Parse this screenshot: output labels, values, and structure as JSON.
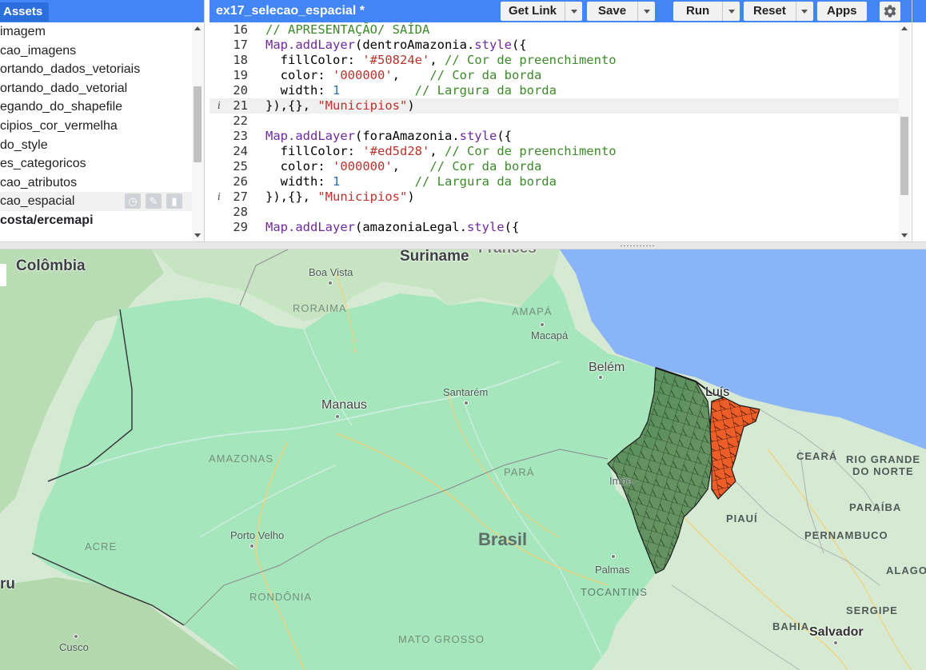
{
  "assets": {
    "tab_label": "Assets",
    "items": [
      {
        "label": "imagem"
      },
      {
        "label": "cao_imagens"
      },
      {
        "label": "ortando_dados_vetoriais"
      },
      {
        "label": "ortando_dado_vetorial"
      },
      {
        "label": "egando_do_shapefile"
      },
      {
        "label": "cipios_cor_vermelha"
      },
      {
        "label": "do_style"
      },
      {
        "label": "es_categoricos"
      },
      {
        "label": "cao_atributos"
      },
      {
        "label": "cao_espacial"
      },
      {
        "label": "costa/ercemapi"
      }
    ],
    "selected_index": 9,
    "action_icons": [
      "history-icon",
      "edit-icon",
      "delete-icon"
    ]
  },
  "editor": {
    "script_name": "ex17_selecao_espacial *",
    "toolbar": {
      "get_link": "Get Link",
      "save": "Save",
      "run": "Run",
      "reset": "Reset",
      "apps": "Apps"
    },
    "info_marker": "i",
    "lines": [
      {
        "n": "16",
        "info": false,
        "tokens": [
          {
            "c": "com",
            "t": "// APRESENTAÇÃO/ SAÍDA"
          }
        ]
      },
      {
        "n": "17",
        "info": false,
        "tokens": [
          {
            "c": "fn",
            "t": "Map.addLayer"
          },
          {
            "c": "id",
            "t": "(dentroAmazonia."
          },
          {
            "c": "fn",
            "t": "style"
          },
          {
            "c": "id",
            "t": "({"
          }
        ]
      },
      {
        "n": "18",
        "info": false,
        "tokens": [
          {
            "c": "id",
            "t": "  fillColor: "
          },
          {
            "c": "str",
            "t": "'#50824e'"
          },
          {
            "c": "id",
            "t": ", "
          },
          {
            "c": "com",
            "t": "// Cor de preenchimento"
          }
        ]
      },
      {
        "n": "19",
        "info": false,
        "tokens": [
          {
            "c": "id",
            "t": "  color: "
          },
          {
            "c": "str",
            "t": "'000000'"
          },
          {
            "c": "id",
            "t": ",    "
          },
          {
            "c": "com",
            "t": "// Cor da borda"
          }
        ]
      },
      {
        "n": "20",
        "info": false,
        "tokens": [
          {
            "c": "id",
            "t": "  width: "
          },
          {
            "c": "num",
            "t": "1"
          },
          {
            "c": "id",
            "t": "          "
          },
          {
            "c": "com",
            "t": "// Largura da borda"
          }
        ]
      },
      {
        "n": "21",
        "info": true,
        "active": true,
        "tokens": [
          {
            "c": "id",
            "t": "}),{}, "
          },
          {
            "c": "str",
            "t": "\"Municipios\""
          },
          {
            "c": "id",
            "t": ")"
          }
        ]
      },
      {
        "n": "22",
        "info": false,
        "tokens": []
      },
      {
        "n": "23",
        "info": false,
        "tokens": [
          {
            "c": "fn",
            "t": "Map.addLayer"
          },
          {
            "c": "id",
            "t": "(foraAmazonia."
          },
          {
            "c": "fn",
            "t": "style"
          },
          {
            "c": "id",
            "t": "({"
          }
        ]
      },
      {
        "n": "24",
        "info": false,
        "tokens": [
          {
            "c": "id",
            "t": "  fillColor: "
          },
          {
            "c": "str",
            "t": "'#ed5d28'"
          },
          {
            "c": "id",
            "t": ", "
          },
          {
            "c": "com",
            "t": "// Cor de preenchimento"
          }
        ]
      },
      {
        "n": "25",
        "info": false,
        "tokens": [
          {
            "c": "id",
            "t": "  color: "
          },
          {
            "c": "str",
            "t": "'000000'"
          },
          {
            "c": "id",
            "t": ",    "
          },
          {
            "c": "com",
            "t": "// Cor da borda"
          }
        ]
      },
      {
        "n": "26",
        "info": false,
        "tokens": [
          {
            "c": "id",
            "t": "  width: "
          },
          {
            "c": "num",
            "t": "1"
          },
          {
            "c": "id",
            "t": "          "
          },
          {
            "c": "com",
            "t": "// Largura da borda"
          }
        ]
      },
      {
        "n": "27",
        "info": true,
        "tokens": [
          {
            "c": "id",
            "t": "}),{}, "
          },
          {
            "c": "str",
            "t": "\"Municipios\""
          },
          {
            "c": "id",
            "t": ")"
          }
        ]
      },
      {
        "n": "28",
        "info": false,
        "tokens": []
      },
      {
        "n": "29",
        "info": false,
        "tokens": [
          {
            "c": "fn",
            "t": "Map.addLayer"
          },
          {
            "c": "id",
            "t": "(amazoniaLegal."
          },
          {
            "c": "fn",
            "t": "style"
          },
          {
            "c": "id",
            "t": "({"
          }
        ]
      }
    ]
  },
  "map": {
    "labels": {
      "colombia": "Colômbia",
      "suriname": "Suriname",
      "francesa": "Frances",
      "boa_vista": "Boa Vista",
      "roraima": "RORAIMA",
      "amapa": "AMAPÁ",
      "macapa": "Macapá",
      "belem": "Belém",
      "luis": "Luís",
      "manaus": "Manaus",
      "santarem": "Santarém",
      "amazonas": "AMAZONAS",
      "para": "PARÁ",
      "impe": "Impe",
      "ceara": "CEARÁ",
      "rio_grande_do_norte_1": "RIO GRANDE",
      "rio_grande_do_norte_2": "DO NORTE",
      "paraiba": "PARAÍBA",
      "piaui": "PIAUÍ",
      "pernambuco": "PERNAMBUCO",
      "porto_velho": "Porto Velho",
      "brasil": "Brasil",
      "acre": "ACRE",
      "alagoas": "ALAGO",
      "palmas": "Palmas",
      "tocantins": "TOCANTINS",
      "rondonia": "RONDÔNIA",
      "sergipe": "SERGIPE",
      "bahia": "BAHIA",
      "cusco": "Cusco",
      "mato_grosso": "MATO GROSSO",
      "salvador": "Salvador",
      "peru": "ru"
    },
    "colors": {
      "amazonia_legal_fill": "#a5e6bc",
      "dentro_amazonia_fill": "#50824e",
      "fora_amazonia_fill": "#ed5d28",
      "ocean": "#8ab4f8",
      "land": "#d6ead3"
    }
  }
}
